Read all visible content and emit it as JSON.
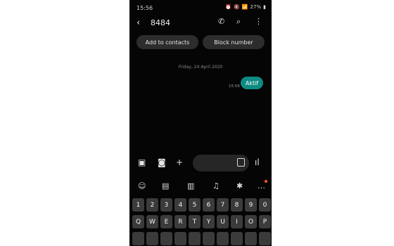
{
  "status": {
    "time": "15:56",
    "battery": "27%"
  },
  "appbar": {
    "back_icon": "back-arrow-icon",
    "contact": "8484",
    "call_icon": "phone-icon",
    "search_icon": "search-icon",
    "menu_icon": "more-vert-icon"
  },
  "actions": {
    "add_label": "Add to contacts",
    "block_label": "Block number"
  },
  "conversation": {
    "date": "Friday, 24 April 2020",
    "message_text": "Aktif",
    "message_time": "15:56"
  },
  "composer": {
    "gallery_icon": "image-icon",
    "camera_icon": "camera-icon",
    "add_icon": "plus-icon",
    "sticker_icon": "sticker-icon",
    "voice_icon": "voice-wave-icon"
  },
  "keyboard_toolbar": {
    "icons": [
      "emoji-icon",
      "sticker-icon",
      "clipboard-icon",
      "mic-icon",
      "settings-icon",
      "more-icon"
    ]
  },
  "keyboard": {
    "row1": [
      "1",
      "2",
      "3",
      "4",
      "5",
      "6",
      "7",
      "8",
      "9",
      "0"
    ],
    "row2": [
      "Q",
      "W",
      "E",
      "R",
      "T",
      "Y",
      "U",
      "I",
      "O",
      "P"
    ]
  }
}
